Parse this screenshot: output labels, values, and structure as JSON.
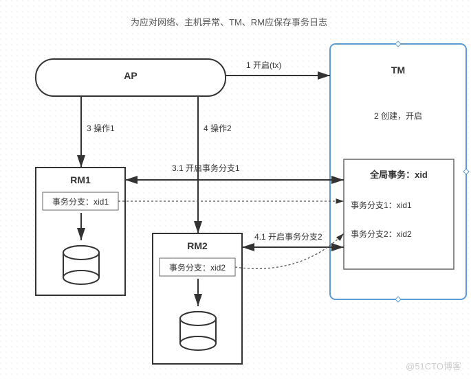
{
  "title": "为应对网络、主机异常、TM、RM应保存事务日志",
  "nodes": {
    "ap": {
      "label": "AP"
    },
    "tm": {
      "label": "TM",
      "note": "2 创建，开启",
      "global_box": {
        "title": "全局事务：xid",
        "branch1": "事务分支1：xid1",
        "branch2": "事务分支2：xid2"
      }
    },
    "rm1": {
      "label": "RM1",
      "inner": "事务分支：xid1"
    },
    "rm2": {
      "label": "RM2",
      "inner": "事务分支：xid2"
    }
  },
  "edges": {
    "e1": "1 开启(tx)",
    "e3": "3 操作1",
    "e4": "4 操作2",
    "e31": "3.1 开启事务分支1",
    "e41": "4.1 开启事务分支2"
  },
  "watermark": "@51CTO博客"
}
